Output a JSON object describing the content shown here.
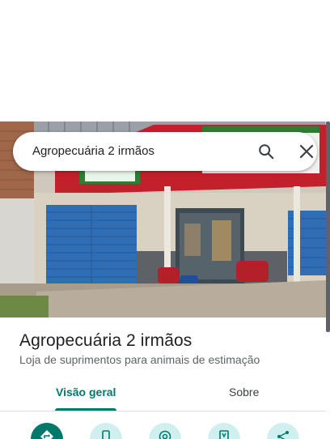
{
  "search": {
    "query": "Agropecuária 2 irmãos"
  },
  "place": {
    "name": "Agropecuária 2 irmãos",
    "category": "Loja de suprimentos para animais de estimação"
  },
  "tabs": [
    {
      "label": "Visão geral",
      "selected": true
    },
    {
      "label": "Sobre",
      "selected": false
    }
  ],
  "actions": [
    {
      "icon": "directions-icon",
      "primary": true
    },
    {
      "icon": "phone-icon",
      "primary": false
    },
    {
      "icon": "location-icon",
      "primary": false
    },
    {
      "icon": "save-icon",
      "primary": false
    },
    {
      "icon": "share-icon",
      "primary": false
    }
  ],
  "colors": {
    "accent": "#00796b",
    "action_background": "#d0f0f0",
    "shutter_blue": "#2f6db5",
    "awning_red": "#c2202b"
  }
}
